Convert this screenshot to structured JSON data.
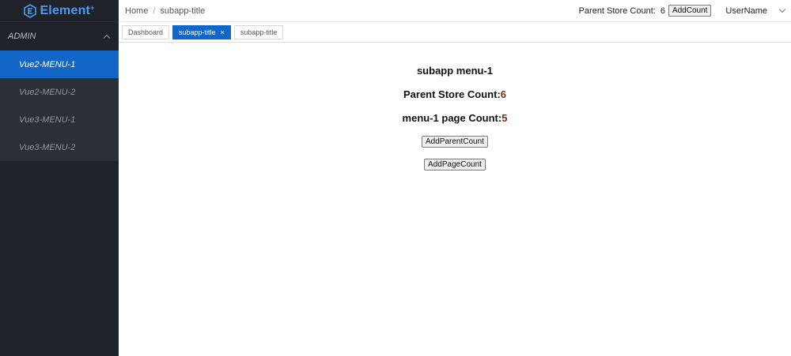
{
  "sidebar": {
    "logo_text": "Element",
    "logo_sup": "+",
    "group_label": "ADMIN",
    "items": [
      {
        "label": "Vue2-MENU-1"
      },
      {
        "label": "Vue2-MENU-2"
      },
      {
        "label": "Vue3-MENU-1"
      },
      {
        "label": "Vue3-MENU-2"
      }
    ]
  },
  "header": {
    "breadcrumb": [
      "Home",
      "subapp-title"
    ],
    "breadcrumb_sep": "/",
    "store_count_label": "Parent Store Count:",
    "store_count_value": "6",
    "add_count_label": "AddCount",
    "username": "UserName"
  },
  "tabs": [
    {
      "label": "Dashboard"
    },
    {
      "label": "subapp-title",
      "close": "×"
    },
    {
      "label": "subapp-title"
    }
  ],
  "main": {
    "title": "subapp menu-1",
    "parent_count_label": "Parent Store Count:",
    "parent_count_value": "6",
    "page_count_label": "menu-1 page Count:",
    "page_count_value": "5",
    "add_parent_button": "AddParentCount",
    "add_page_button": "AddPageCount"
  },
  "colors": {
    "sidebar_bg": "#1f2229",
    "active": "#1166c8",
    "count_value": "#7a2e22"
  }
}
